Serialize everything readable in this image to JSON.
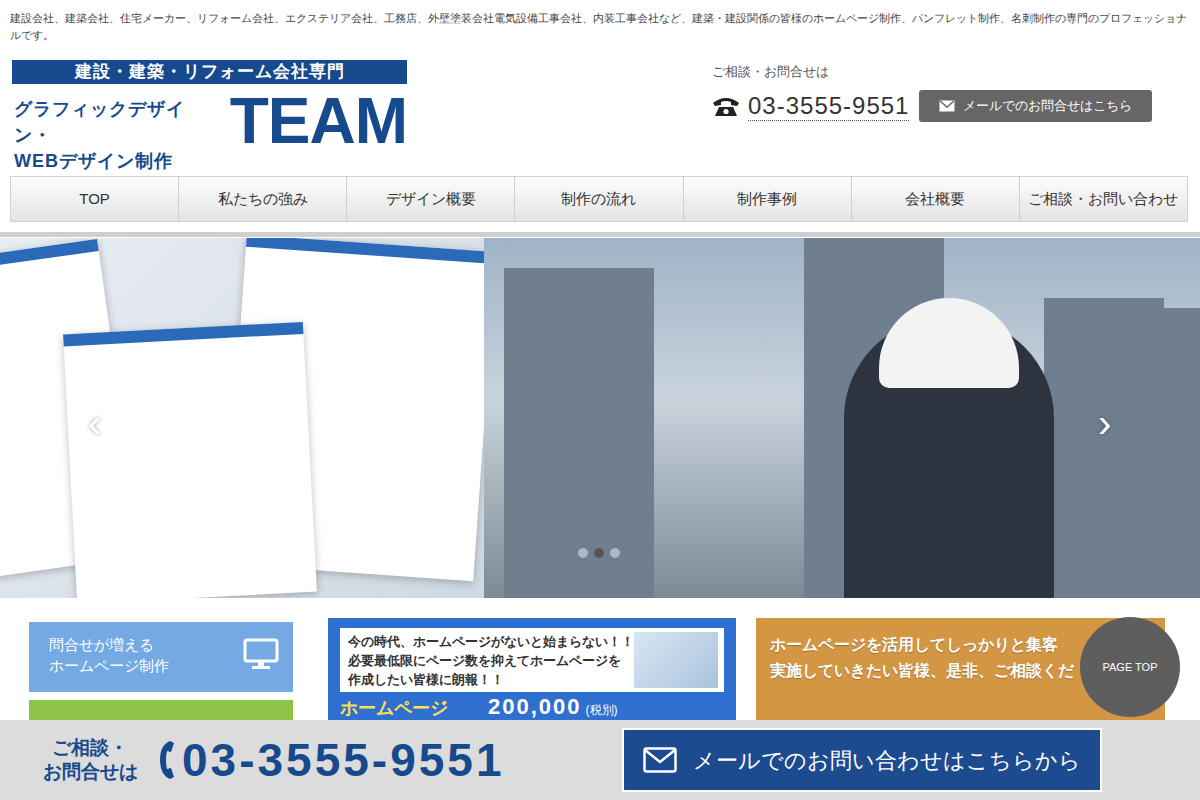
{
  "tagline": "建設会社、建築会社、住宅メーカー、リフォーム会社、エクステリア会社、工務店、外壁塗装会社電気設備工事会社、内装工事会社など、建築・建設関係の皆様のホームページ制作、パンフレット制作、名刺制作の専門のプロフェッショナルです。",
  "logo": {
    "badge": "建設・建築・リフォーム会社専門",
    "line1": "グラフィックデザイン・",
    "line2": "WEBデザイン制作",
    "brand": "TEAM"
  },
  "contact": {
    "label": "ご相談・お問合せは",
    "phone": "03-3555-9551",
    "mail_button": "メールでのお問合せはこちら"
  },
  "nav": [
    {
      "label": "TOP",
      "selected": false
    },
    {
      "label": "私たちの強み",
      "selected": false
    },
    {
      "label": "デザイン概要",
      "selected": false
    },
    {
      "label": "制作の流れ",
      "selected": false
    },
    {
      "label": "制作事例",
      "selected": false
    },
    {
      "label": "会社概要",
      "selected": false
    },
    {
      "label": "ご相談・お問い合わせ",
      "selected": false
    }
  ],
  "slider": {
    "prev": "‹",
    "next": "›",
    "dots": [
      {
        "selected": false
      },
      {
        "selected": true
      },
      {
        "selected": false
      }
    ]
  },
  "features": {
    "left": {
      "lines": [
        "問合せが増える",
        "ホームページ制作"
      ]
    },
    "middle": {
      "lines": [
        "今の時代、ホームページがないと始まらない！！",
        "必要最低限にページ数を抑えてホームページを",
        "作成したい皆様に朗報！！"
      ],
      "price_label": "ホームページ",
      "price": "200,000",
      "tax": "(税別)"
    },
    "right": {
      "lines": [
        "ホームページを活用してしっかりと集客",
        "実施していきたい皆様、是非、ご相談くだ"
      ]
    }
  },
  "page_top": "PAGE TOP",
  "footer": {
    "label_lines": [
      "ご相談・",
      "お問合せは"
    ],
    "phone": "03-3555-9551",
    "mail_button": "メールでのお問い合わせはこちらから"
  }
}
